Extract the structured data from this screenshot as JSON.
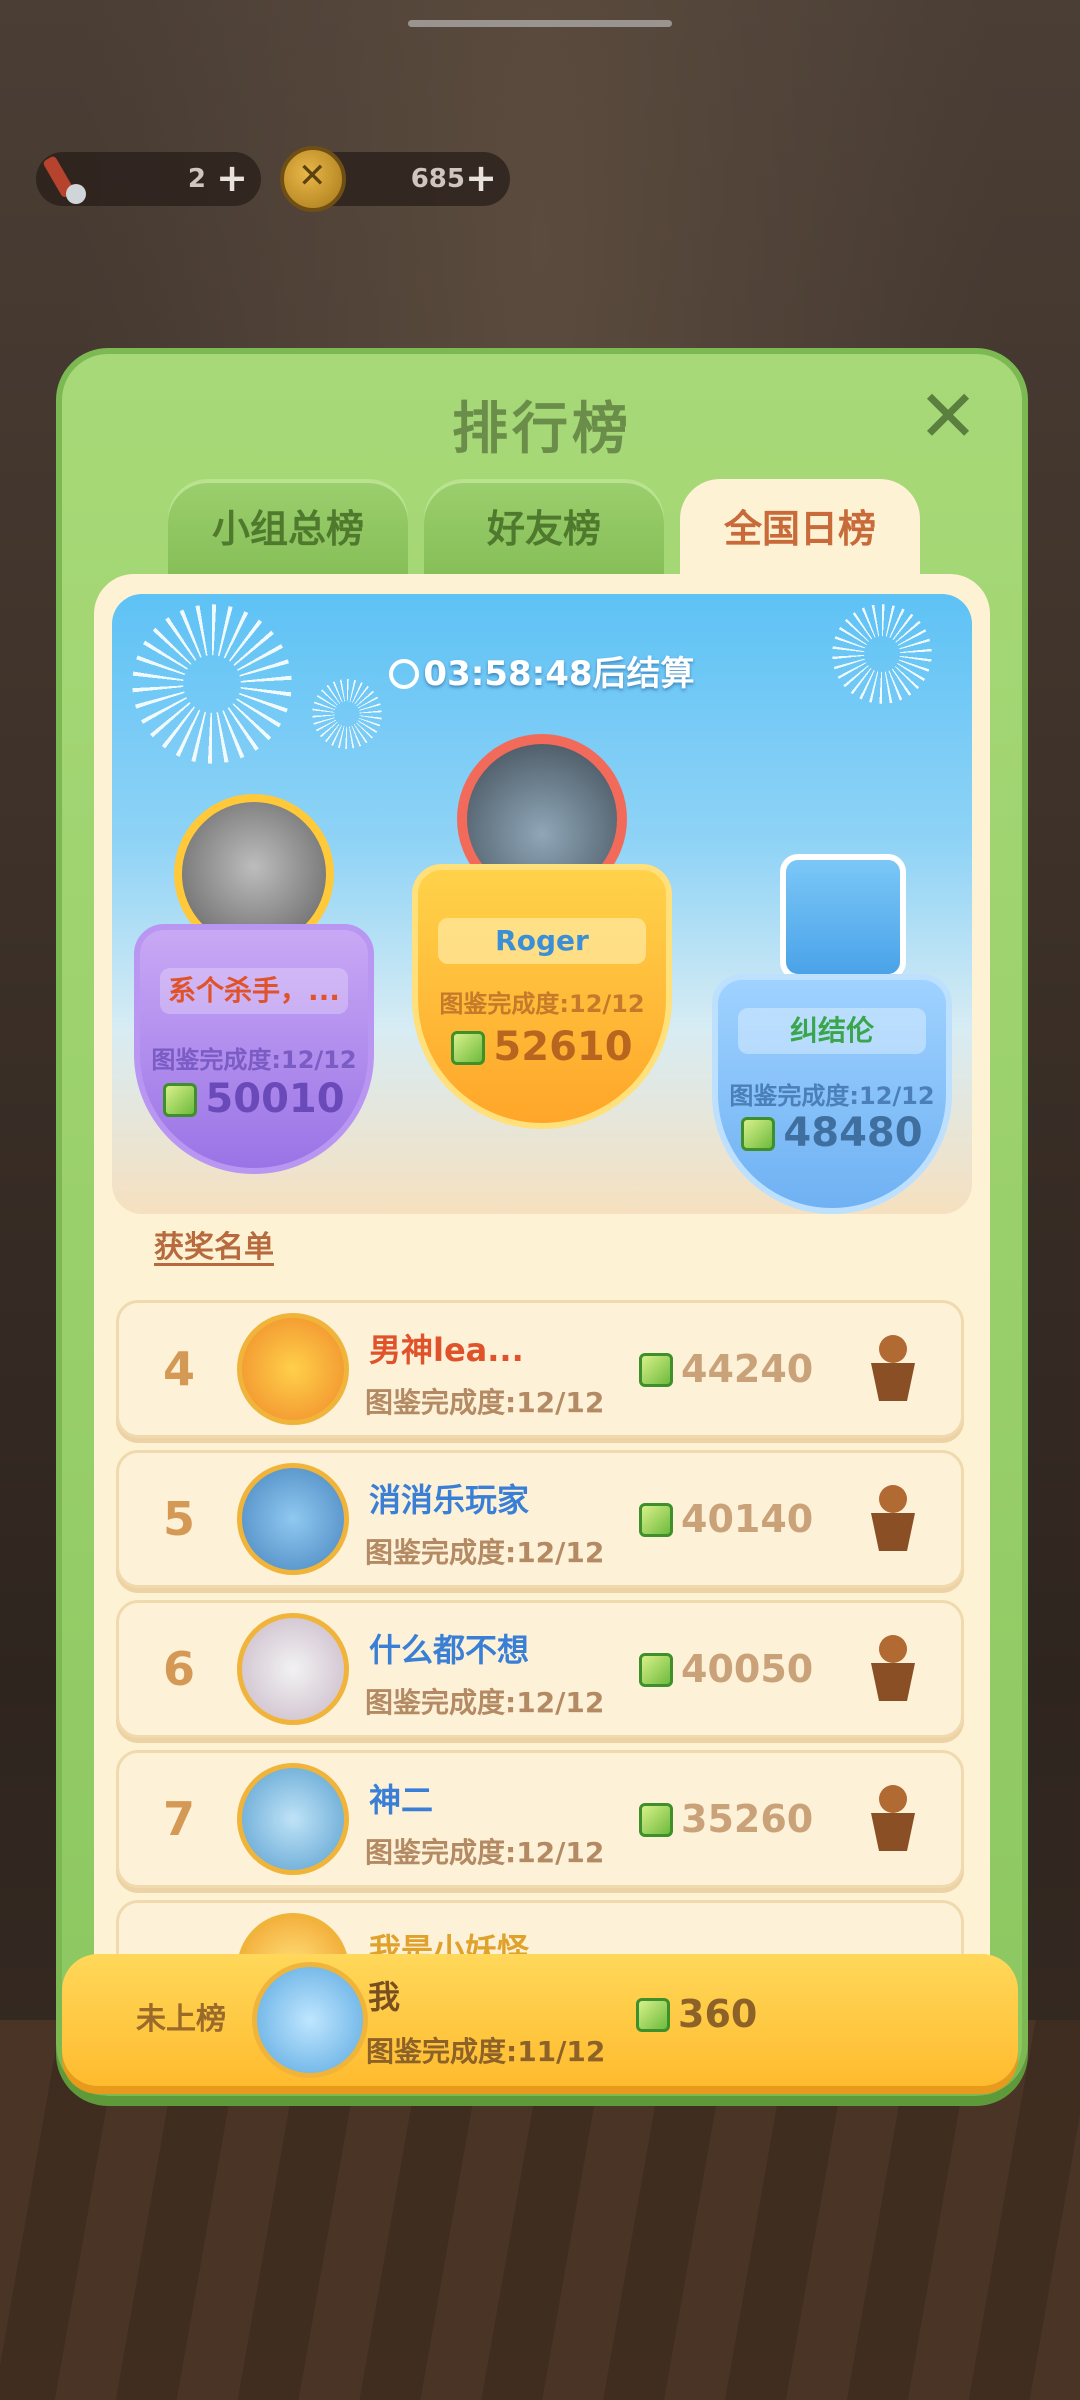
{
  "resources": [
    {
      "icon": "pencil-icon",
      "value": "2",
      "plus": "+"
    },
    {
      "icon": "coin-icon",
      "value": "685",
      "plus": "+"
    }
  ],
  "panel": {
    "title": "排行榜",
    "close": "✕"
  },
  "tabs": [
    {
      "label": "小组总榜",
      "active": false
    },
    {
      "label": "好友榜",
      "active": false
    },
    {
      "label": "全国日榜",
      "active": true
    }
  ],
  "timer": {
    "text": "03:58:48后结算"
  },
  "podium": [
    {
      "place": 2,
      "name": "系个杀手，...",
      "completion": "图鉴完成度:12/12",
      "score": "50010"
    },
    {
      "place": 1,
      "name": "Roger",
      "completion": "图鉴完成度:12/12",
      "score": "52610"
    },
    {
      "place": 3,
      "name": "纠结伦",
      "completion": "图鉴完成度:12/12",
      "score": "48480"
    }
  ],
  "section_label": "获奖名单",
  "rows": [
    {
      "rank": "4",
      "name": "男神lea...",
      "name_color": "#e0522a",
      "completion": "图鉴完成度:12/12",
      "score": "44240"
    },
    {
      "rank": "5",
      "name": "消消乐玩家",
      "name_color": "#3a7fd6",
      "completion": "图鉴完成度:12/12",
      "score": "40140"
    },
    {
      "rank": "6",
      "name": "什么都不想",
      "name_color": "#3a7fd6",
      "completion": "图鉴完成度:12/12",
      "score": "40050"
    },
    {
      "rank": "7",
      "name": "神二",
      "name_color": "#3a7fd6",
      "completion": "图鉴完成度:12/12",
      "score": "35260"
    },
    {
      "rank": "",
      "name": "我是小妖怪...",
      "name_color": "#e0a22a",
      "completion": "",
      "score": ""
    }
  ],
  "me": {
    "notice": "未上榜",
    "name": "我",
    "completion": "图鉴完成度:11/12",
    "score": "360"
  }
}
